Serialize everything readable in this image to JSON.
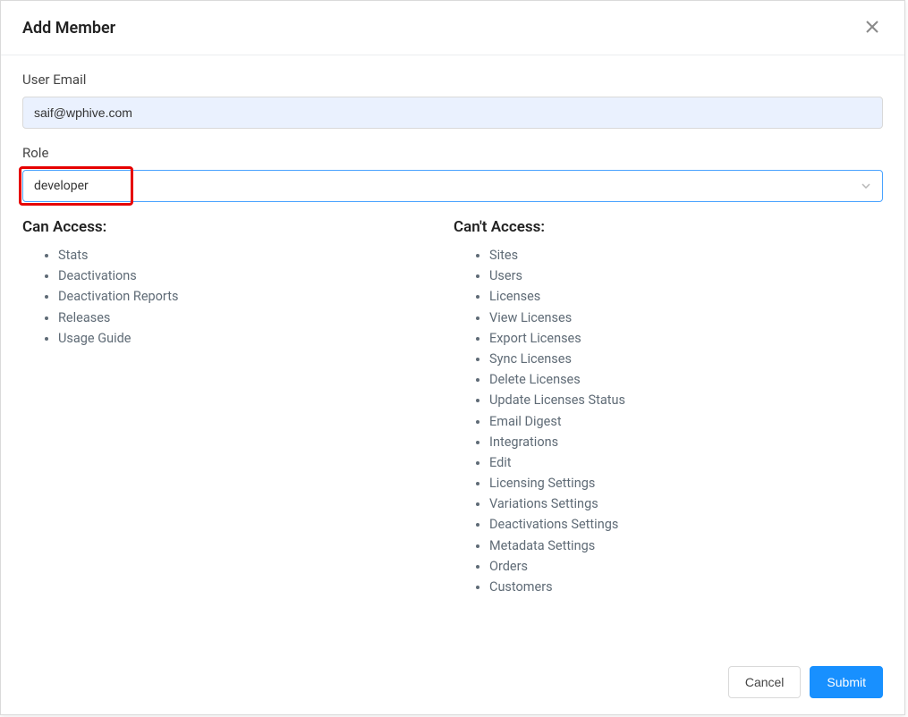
{
  "modal": {
    "title": "Add Member"
  },
  "form": {
    "email_label": "User Email",
    "email_value": "saif@wphive.com",
    "role_label": "Role",
    "role_value": "developer"
  },
  "access": {
    "can_title": "Can Access:",
    "can_items": [
      "Stats",
      "Deactivations",
      "Deactivation Reports",
      "Releases",
      "Usage Guide"
    ],
    "cant_title": "Can't Access:",
    "cant_items": [
      "Sites",
      "Users",
      "Licenses",
      "View Licenses",
      "Export Licenses",
      "Sync Licenses",
      "Delete Licenses",
      "Update Licenses Status",
      "Email Digest",
      "Integrations",
      "Edit",
      "Licensing Settings",
      "Variations Settings",
      "Deactivations Settings",
      "Metadata Settings",
      "Orders",
      "Customers"
    ]
  },
  "footer": {
    "cancel_label": "Cancel",
    "submit_label": "Submit"
  }
}
